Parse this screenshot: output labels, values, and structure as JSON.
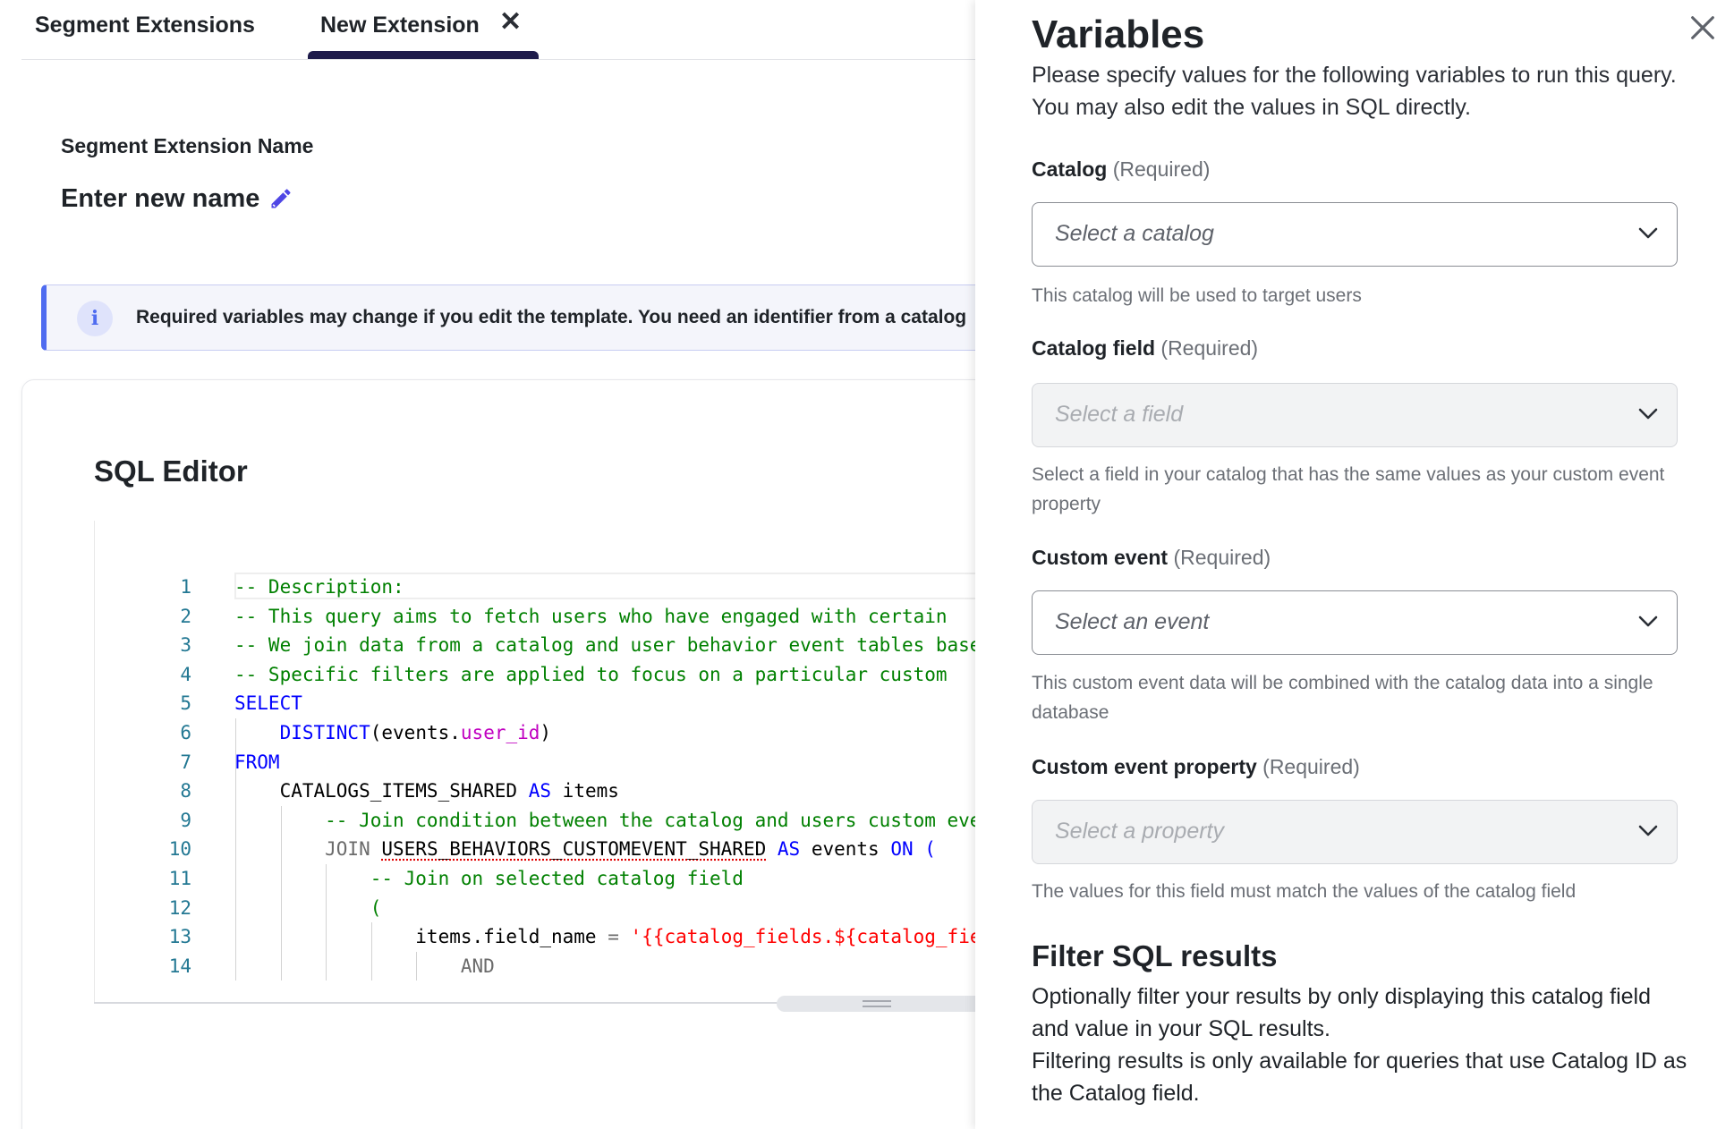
{
  "tabs": [
    {
      "label": "Segment Extensions"
    },
    {
      "label": "New Extension"
    }
  ],
  "name_section": {
    "label": "Segment Extension Name",
    "value": "Enter new name"
  },
  "banner": {
    "text": "Required variables may change if you edit the template. You need an identifier from a catalog"
  },
  "sql_editor": {
    "title": "SQL Editor",
    "active_line": 1
  },
  "code_lines": [
    {
      "n": "1",
      "segments": [
        {
          "t": "-- Description:",
          "c": "com"
        }
      ]
    },
    {
      "n": "2",
      "segments": [
        {
          "t": "-- This query aims to fetch users who have engaged with certain",
          "c": "com"
        }
      ]
    },
    {
      "n": "3",
      "segments": [
        {
          "t": "-- We join data from a catalog and user behavior event tables based",
          "c": "com"
        }
      ]
    },
    {
      "n": "4",
      "segments": [
        {
          "t": "-- Specific filters are applied to focus on a particular custom",
          "c": "com"
        }
      ]
    },
    {
      "n": "5",
      "segments": [
        {
          "t": "SELECT",
          "c": "kw"
        }
      ]
    },
    {
      "n": "6",
      "segments": [
        {
          "t": "    ",
          "c": "plain"
        },
        {
          "t": "DISTINCT",
          "c": "kw"
        },
        {
          "t": "(",
          "c": "plain"
        },
        {
          "t": "events",
          "c": "plain"
        },
        {
          "t": ".",
          "c": "plain"
        },
        {
          "t": "user_id",
          "c": "mag"
        },
        {
          "t": ")",
          "c": "plain"
        }
      ]
    },
    {
      "n": "7",
      "segments": [
        {
          "t": "FROM",
          "c": "kw"
        }
      ]
    },
    {
      "n": "8",
      "segments": [
        {
          "t": "    CATALOGS_ITEMS_SHARED ",
          "c": "plain"
        },
        {
          "t": "AS",
          "c": "kw"
        },
        {
          "t": " items",
          "c": "plain"
        }
      ]
    },
    {
      "n": "9",
      "segments": [
        {
          "t": "        -- Join condition between the catalog and users custom event",
          "c": "com"
        }
      ]
    },
    {
      "n": "10",
      "segments": [
        {
          "t": "        JOIN ",
          "c": "gray"
        },
        {
          "t": "USERS_BEHAVIORS_CUSTOMEVENT_SHARED",
          "c": "under"
        },
        {
          "t": " ",
          "c": "plain"
        },
        {
          "t": "AS",
          "c": "kw"
        },
        {
          "t": " events ",
          "c": "plain"
        },
        {
          "t": "ON",
          "c": "kw"
        },
        {
          "t": " (",
          "c": "kw"
        }
      ]
    },
    {
      "n": "11",
      "segments": [
        {
          "t": "            -- Join on selected catalog field",
          "c": "com"
        }
      ]
    },
    {
      "n": "12",
      "segments": [
        {
          "t": "            (",
          "c": "com"
        }
      ]
    },
    {
      "n": "13",
      "segments": [
        {
          "t": "                items.field_name ",
          "c": "plain"
        },
        {
          "t": "=",
          "c": "gray"
        },
        {
          "t": " ",
          "c": "plain"
        },
        {
          "t": "'{{catalog_fields.${catalog_field}}}'",
          "c": "str"
        }
      ]
    },
    {
      "n": "14",
      "segments": [
        {
          "t": "                    AND",
          "c": "gray"
        }
      ]
    }
  ],
  "drawer": {
    "title": "Variables",
    "description": "Please specify values for the following variables to run this query. You may also edit the values in SQL directly.",
    "fields": [
      {
        "label": "Catalog",
        "required": "(Required)",
        "placeholder": "Select a catalog",
        "disabled": false,
        "help": "This catalog will be used to target users"
      },
      {
        "label": "Catalog field",
        "required": "(Required)",
        "placeholder": "Select a field",
        "disabled": true,
        "help": "Select a field in your catalog that has the same values as your custom event property"
      },
      {
        "label": "Custom event",
        "required": "(Required)",
        "placeholder": "Select an event",
        "disabled": false,
        "help": "This custom event data will be combined with the catalog data into a single database"
      },
      {
        "label": "Custom event property",
        "required": "(Required)",
        "placeholder": "Select a property",
        "disabled": true,
        "help": "The values for this field must match the values of the catalog field"
      }
    ],
    "filter": {
      "title": "Filter SQL results",
      "description_1": "Optionally filter your results by only displaying this catalog field and value in your SQL results.",
      "description_2": "Filtering results is only available for queries that use Catalog ID as the Catalog field."
    }
  },
  "colors": {
    "tab_underline": "#1e1b4b",
    "banner_accent": "#4f6cf0",
    "pencil": "#4f46e5",
    "sql_comment": "#008000",
    "sql_keyword": "#0000ff",
    "sql_string": "#ff0000",
    "line_number": "#237893"
  }
}
